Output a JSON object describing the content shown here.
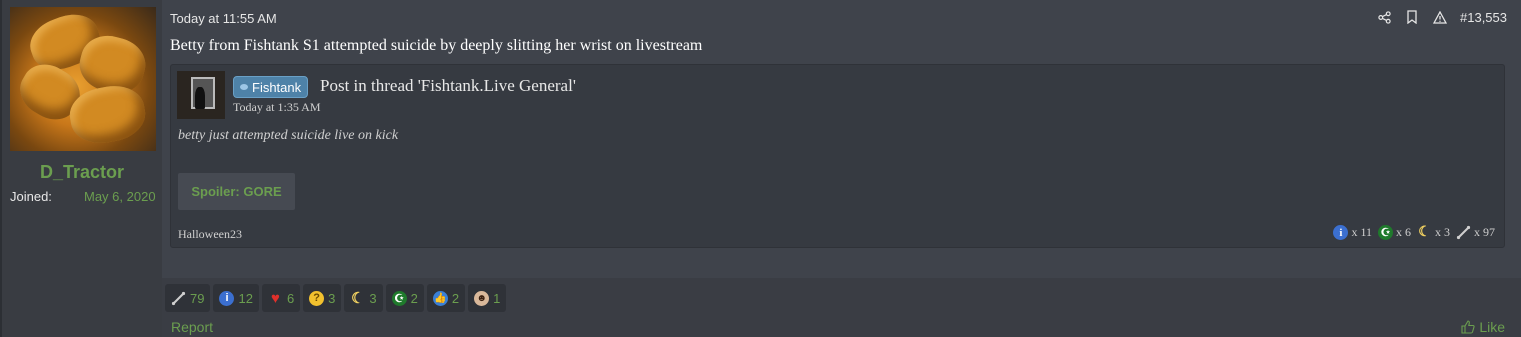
{
  "user": {
    "name": "D_Tractor",
    "joined_label": "Joined:",
    "joined_value": "May 6, 2020"
  },
  "post": {
    "timestamp": "Today at 11:55 AM",
    "number": "#13,553",
    "title": "Betty from Fishtank S1 attempted suicide by deeply slitting her wrist on livestream",
    "actions": [
      "share-icon",
      "bookmark-icon",
      "report-warning-icon"
    ]
  },
  "quote": {
    "forum_tag": "Fishtank",
    "post_label": "Post in thread 'Fishtank.Live General'",
    "time": "Today at 1:35 AM",
    "body": "betty just attempted suicide live on kick",
    "spoiler_label": "Spoiler: GORE",
    "signature": "Halloween23",
    "reactions": [
      {
        "icon": "info-icon",
        "count": "x 11"
      },
      {
        "icon": "crescent-star-icon",
        "count": "x 6"
      },
      {
        "icon": "moon-icon",
        "count": "x 3"
      },
      {
        "icon": "bone-icon",
        "count": "x 97"
      }
    ]
  },
  "reaction_bar": [
    {
      "icon": "bone-icon",
      "count": "79"
    },
    {
      "icon": "info-icon",
      "count": "12"
    },
    {
      "icon": "heart-icon",
      "count": "6"
    },
    {
      "icon": "thinking-face-icon",
      "count": "3"
    },
    {
      "icon": "moon-icon",
      "count": "3"
    },
    {
      "icon": "crescent-star-icon",
      "count": "2"
    },
    {
      "icon": "thumbs-up-icon",
      "count": "2"
    },
    {
      "icon": "face-icon",
      "count": "1"
    }
  ],
  "footer": {
    "report_label": "Report",
    "like_label": "Like"
  },
  "colors": {
    "accent_green": "#6b9e4f",
    "tag_blue": "#4e82a8",
    "background": "#3f434b"
  }
}
